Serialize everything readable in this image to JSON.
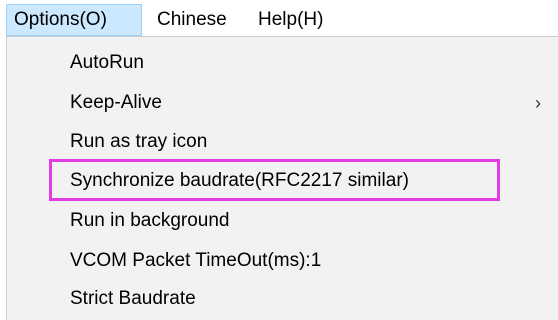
{
  "menubar": {
    "items": [
      {
        "label": "Options(O)",
        "active": true
      },
      {
        "label": "Chinese",
        "active": false
      },
      {
        "label": "Help(H)",
        "active": false
      }
    ]
  },
  "options_menu": {
    "items": [
      {
        "label": "AutoRun"
      },
      {
        "label": "Keep-Alive",
        "submenu_glyph": "›"
      },
      {
        "label": "Run as tray icon"
      },
      {
        "label": "Synchronize baudrate(RFC2217 similar)",
        "highlighted": true
      },
      {
        "label": "Run in background"
      },
      {
        "label": "VCOM Packet TimeOut(ms):1"
      },
      {
        "label": "Strict Baudrate"
      }
    ]
  },
  "colors": {
    "menubar_active_bg": "#cce8ff",
    "menubar_active_border": "#99d1ff",
    "dropdown_bg": "#f2f2f2",
    "highlight_border": "#e13be6"
  }
}
